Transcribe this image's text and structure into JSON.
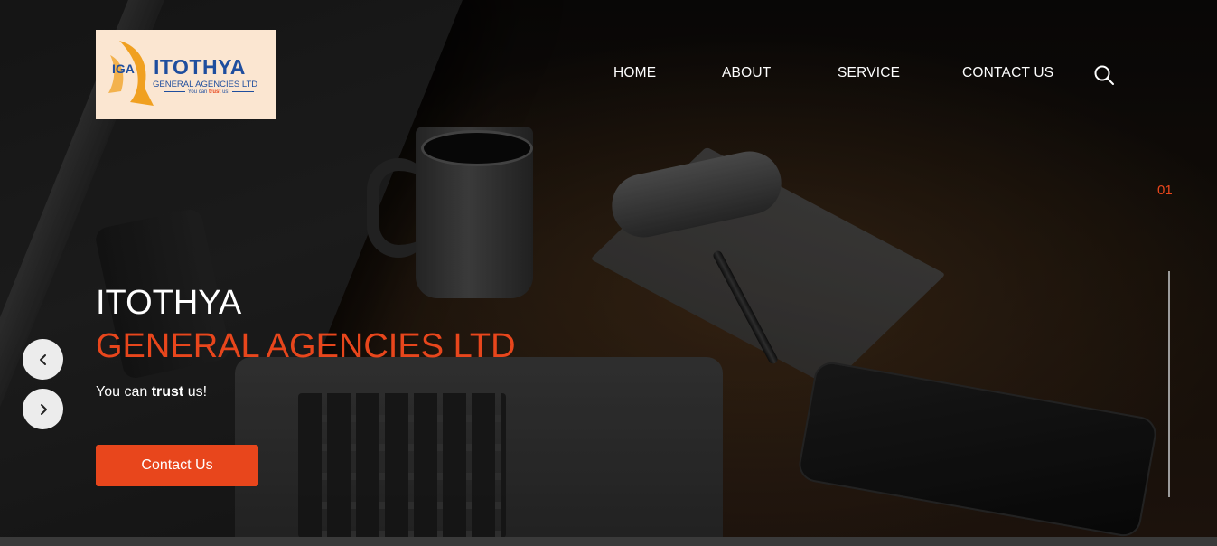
{
  "logo": {
    "letters": "IGA",
    "name": "ITOTHYA",
    "subname": "GENERAL AGENCIES LTD",
    "tagline_pre": "You can",
    "tagline_bold": "trust",
    "tagline_post": "us!",
    "colors": {
      "background": "#fbe6d1",
      "primary": "#1f4e9e",
      "accent": "#f0a020"
    }
  },
  "nav": {
    "items": [
      {
        "label": "HOME"
      },
      {
        "label": "ABOUT"
      },
      {
        "label": "SERVICE"
      },
      {
        "label": "CONTACT US"
      }
    ],
    "search_icon": "search-icon"
  },
  "slider": {
    "current": "01",
    "prev_icon": "chevron-left-icon",
    "next_icon": "chevron-right-icon"
  },
  "hero": {
    "title_line1": "ITOTHYA",
    "title_line2": "GENERAL AGENCIES LTD",
    "tagline_pre": "You can",
    "tagline_bold": "trust",
    "tagline_post": "us!",
    "cta_label": "Contact Us"
  },
  "colors": {
    "accent": "#e8461c",
    "text": "#ffffff"
  }
}
